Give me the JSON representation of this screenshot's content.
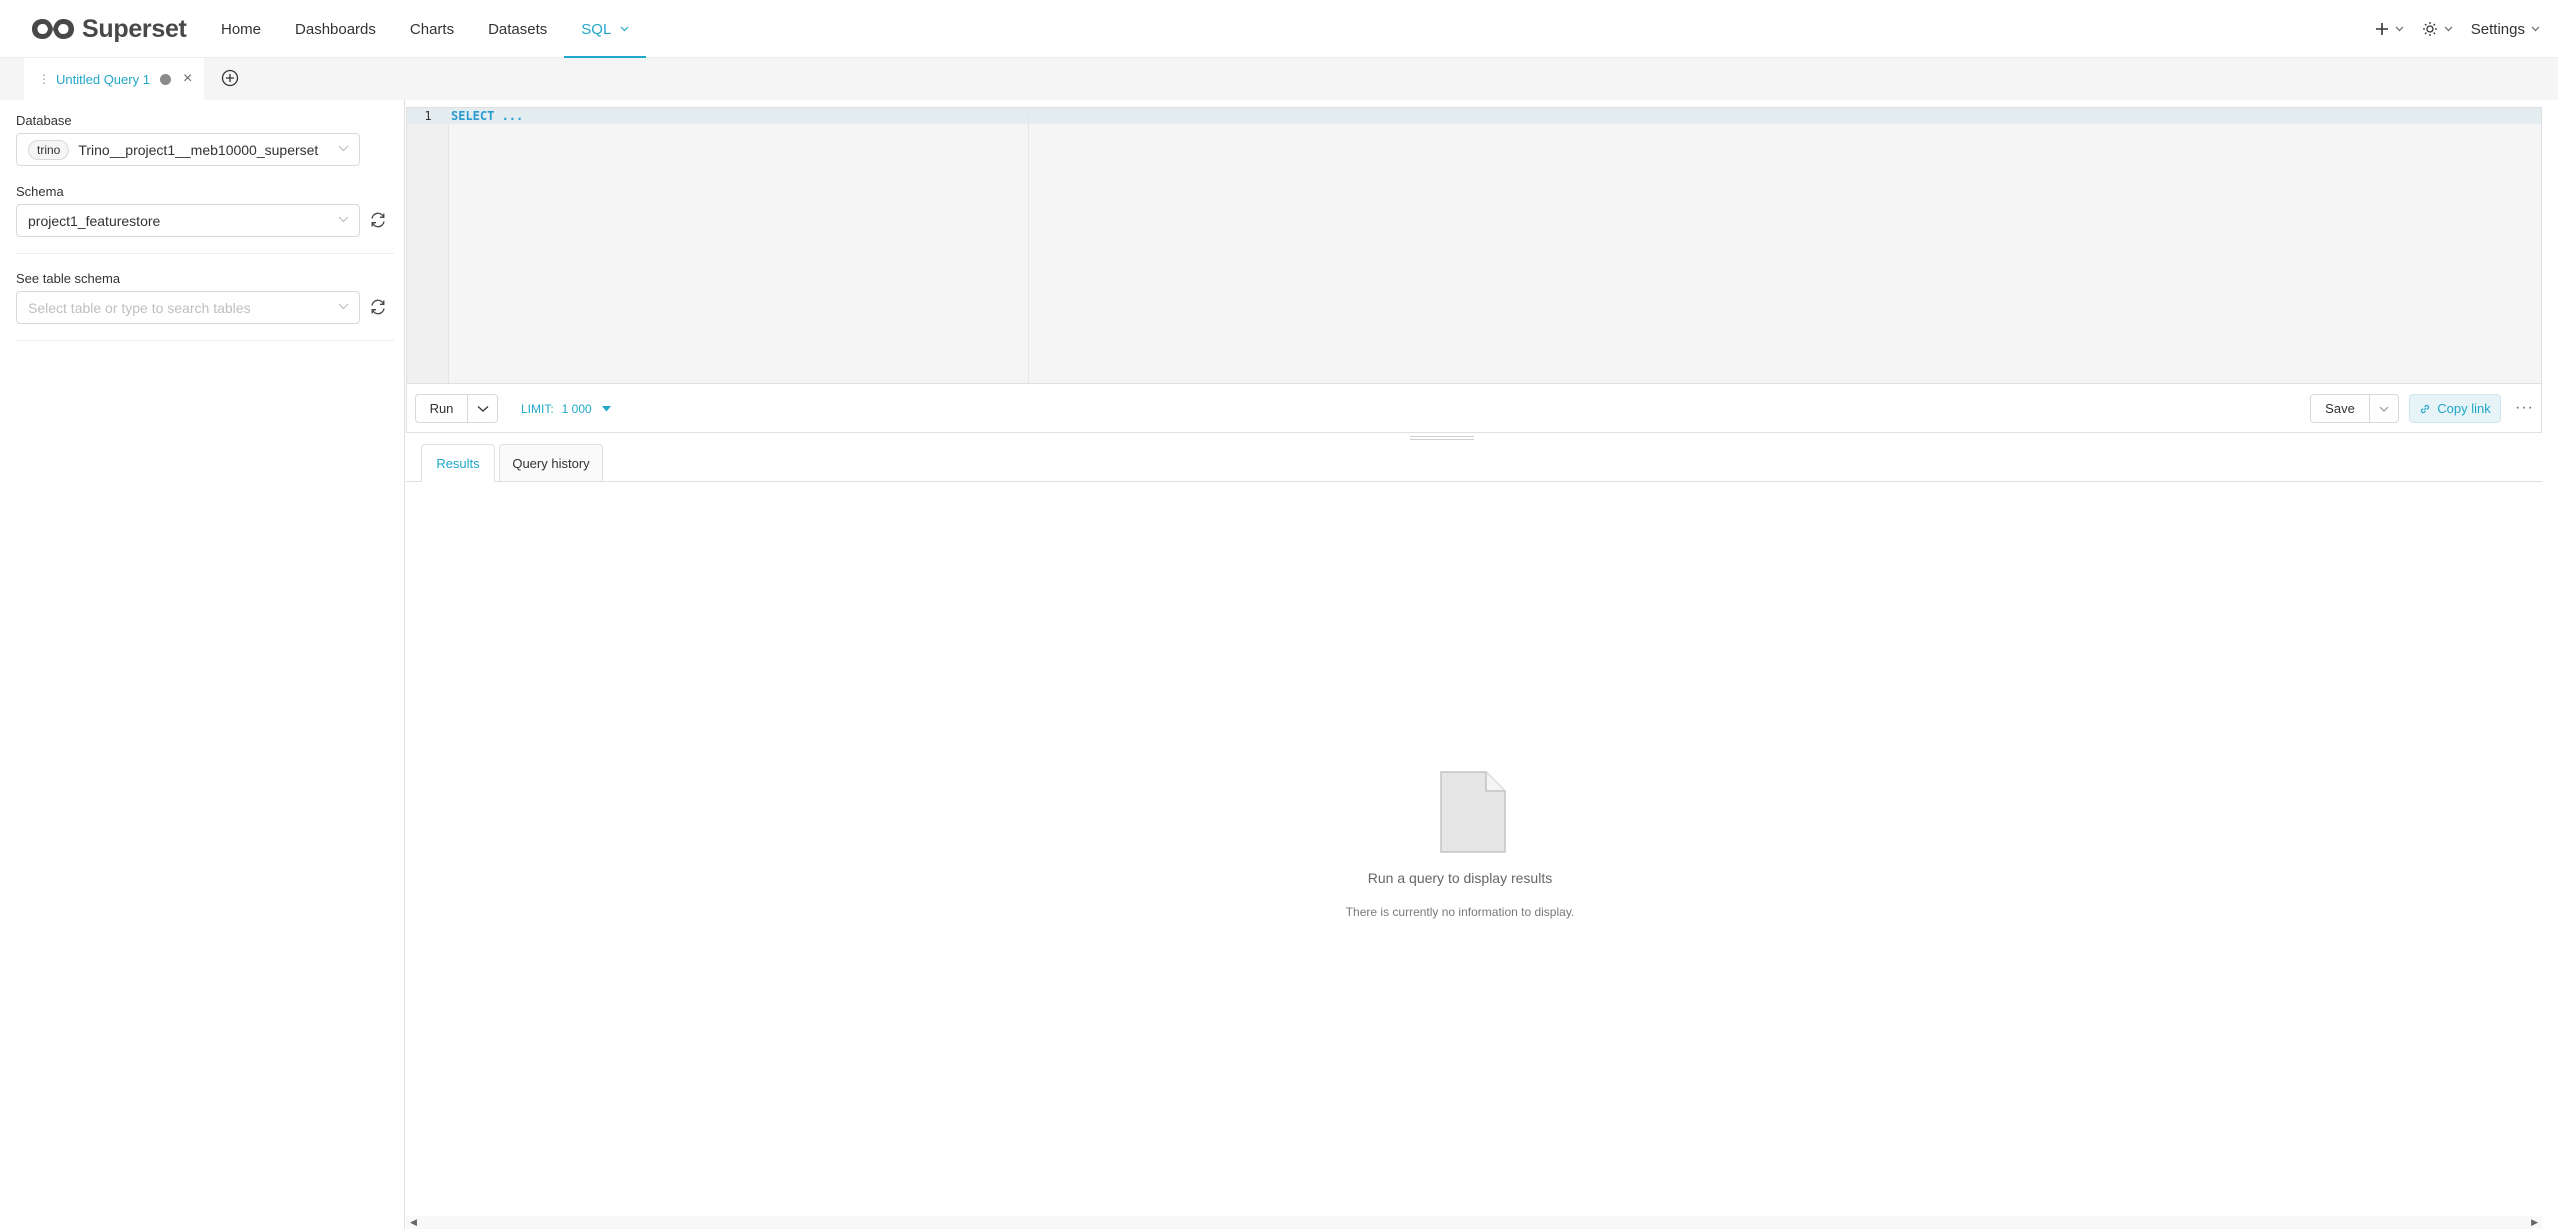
{
  "app": {
    "brand": "Superset"
  },
  "nav": {
    "links": [
      "Home",
      "Dashboards",
      "Charts",
      "Datasets",
      "SQL"
    ],
    "active": "SQL",
    "settings_label": "Settings"
  },
  "tabs": {
    "query_tab_label": "Untitled Query 1"
  },
  "left": {
    "database_label": "Database",
    "database_tag": "trino",
    "database_value": "Trino__project1__meb10000_superset",
    "schema_label": "Schema",
    "schema_value": "project1_featurestore",
    "table_label": "See table schema",
    "table_placeholder": "Select table or type to search tables"
  },
  "editor": {
    "line_number": "1",
    "code": "SELECT ..."
  },
  "toolbar": {
    "run_label": "Run",
    "limit_label": "LIMIT:",
    "limit_value": "1 000",
    "save_label": "Save",
    "copy_link_label": "Copy link",
    "more_label": "···"
  },
  "results": {
    "tab_results": "Results",
    "tab_history": "Query history",
    "empty_title": "Run a query to display results",
    "empty_sub": "There is currently no information to display."
  },
  "colors": {
    "accent": "#20a7c9",
    "text": "#333333"
  }
}
